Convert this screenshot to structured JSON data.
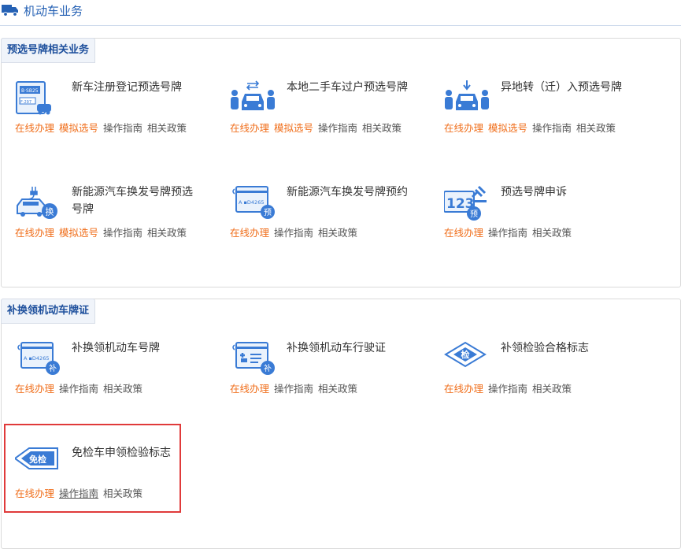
{
  "header": {
    "title": "机动车业务",
    "icon": "truck-icon"
  },
  "colors": {
    "primary": "#2561b4",
    "accent": "#f06f1c",
    "highlight": "#e03a3a",
    "icon": "#3a7bd5"
  },
  "sections": [
    {
      "title": "预选号牌相关业务",
      "items": [
        {
          "name": "新车注册登记预选号牌",
          "icon": "plate-registration-icon",
          "links": [
            "在线办理",
            "模拟选号",
            "操作指南",
            "相关政策"
          ]
        },
        {
          "name": "本地二手车过户预选号牌",
          "icon": "car-transfer-icon",
          "links": [
            "在线办理",
            "模拟选号",
            "操作指南",
            "相关政策"
          ]
        },
        {
          "name": "异地转（迁）入预选号牌",
          "icon": "car-import-icon",
          "links": [
            "在线办理",
            "模拟选号",
            "操作指南",
            "相关政策"
          ]
        },
        {
          "name": "新能源汽车换发号牌预选号牌",
          "icon": "ev-plate-exchange-icon",
          "badge": "换",
          "links": [
            "在线办理",
            "模拟选号",
            "操作指南",
            "相关政策"
          ]
        },
        {
          "name": "新能源汽车换发号牌预约",
          "icon": "plate-reservation-icon",
          "badge": "预",
          "plate_text": "A ▪D4265",
          "links": [
            "在线办理",
            "操作指南",
            "相关政策"
          ]
        },
        {
          "name": "预选号牌申诉",
          "icon": "plate-appeal-icon",
          "badge": "预",
          "plate_text": "123",
          "links": [
            "在线办理",
            "操作指南",
            "相关政策"
          ]
        }
      ]
    },
    {
      "title": "补换领机动车牌证",
      "items": [
        {
          "name": "补换领机动车号牌",
          "icon": "plate-reissue-icon",
          "badge": "补",
          "plate_text": "A ▪D4265",
          "links": [
            "在线办理",
            "操作指南",
            "相关政策"
          ]
        },
        {
          "name": "补换领机动车行驶证",
          "icon": "license-reissue-icon",
          "badge": "补",
          "links": [
            "在线办理",
            "操作指南",
            "相关政策"
          ]
        },
        {
          "name": "补领检验合格标志",
          "icon": "inspection-mark-icon",
          "badge": "检",
          "links": [
            "在线办理",
            "操作指南",
            "相关政策"
          ]
        },
        {
          "name": "免检车申领检验标志",
          "icon": "exempt-inspection-icon",
          "badge": "免检",
          "links": [
            "在线办理",
            "操作指南",
            "相关政策"
          ]
        }
      ]
    }
  ]
}
